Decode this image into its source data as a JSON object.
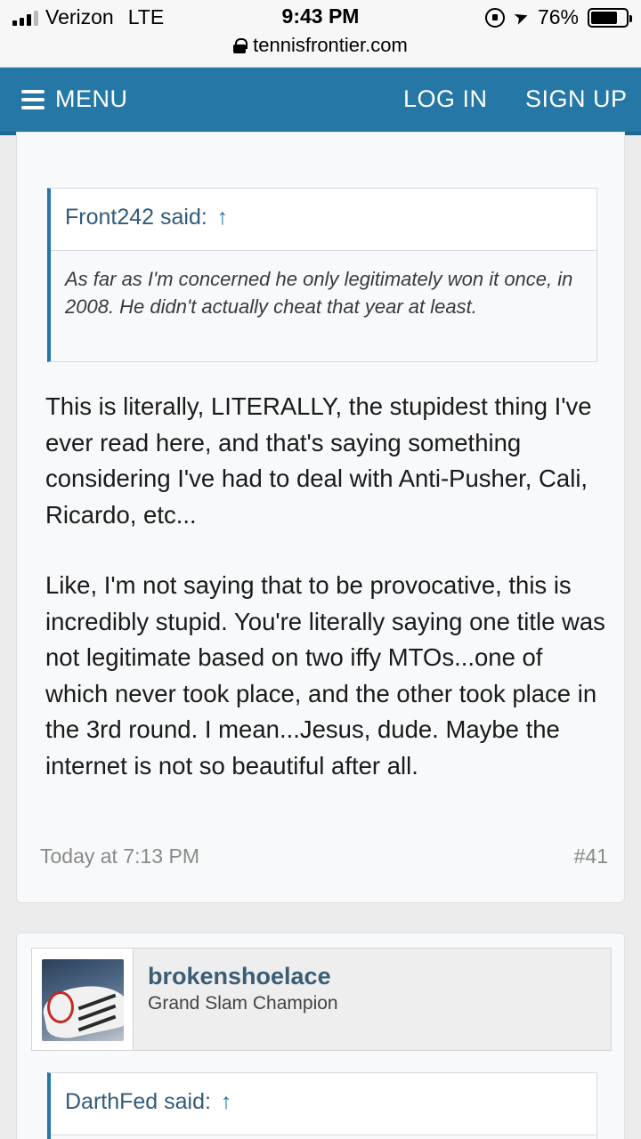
{
  "status_bar": {
    "carrier": "Verizon",
    "network": "LTE",
    "time": "9:43 PM",
    "battery": "76%",
    "battery_level": 0.76,
    "url": "tennisfrontier.com"
  },
  "nav": {
    "menu_label": "MENU",
    "login_label": "LOG IN",
    "signup_label": "SIGN UP"
  },
  "post1": {
    "quote": {
      "author": "Front242 said:",
      "arrow": "↑",
      "text": "As far as I'm concerned he only legitimately won it once, in 2008. He didn't actually cheat that year at least."
    },
    "paragraphs": [
      "This is literally, LITERALLY, the stupidest thing I've ever read here, and that's saying something considering I've had to deal with Anti-Pusher, Cali, Ricardo, etc...",
      "Like, I'm not saying that to be provocative, this is incredibly stupid. You're literally saying one title was not legitimate based on two iffy MTOs...one of which never took place, and the other took place in the 3rd round. I mean...Jesus, dude. Maybe the internet is not so beautiful after all."
    ],
    "date": "Today at 7:13 PM",
    "number": "#41"
  },
  "post2": {
    "username": "brokenshoelace",
    "user_title": "Grand Slam Champion",
    "quote": {
      "author": "DarthFed said:",
      "arrow": "↑"
    }
  }
}
